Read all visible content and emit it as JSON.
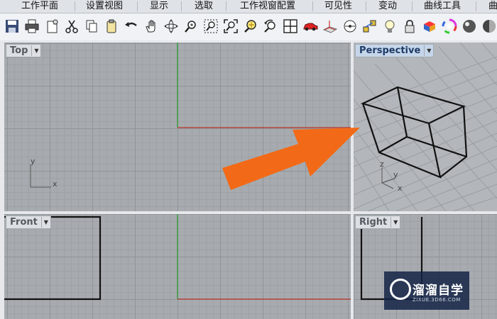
{
  "menu": {
    "tabs": [
      "工作平面",
      "设置视图",
      "显示",
      "选取",
      "工作视窗配置",
      "可见性",
      "变动",
      "曲线工具",
      "曲"
    ]
  },
  "toolbar": {
    "icons": [
      "save-icon",
      "print-icon",
      "page-setup-icon",
      "cut-icon",
      "copy-icon",
      "paste-icon",
      "undo-icon",
      "pan-icon",
      "rotate-view-icon",
      "zoom-icon",
      "zoom-window-icon",
      "zoom-extents-icon",
      "zoom-selected-icon",
      "undo-view-icon",
      "four-viewports-icon",
      "car-icon",
      "named-cplane-icon",
      "cplane-icon",
      "object-snap-icon",
      "light-icon",
      "lock-icon",
      "material-icon",
      "color-wheel-icon",
      "render-sphere-icon",
      "shaded-sphere-icon",
      "more-sphere-icon"
    ]
  },
  "viewports": {
    "top": {
      "label": "Top",
      "axis_x": "x",
      "axis_y": "y"
    },
    "persp": {
      "label": "Perspective",
      "axis_x": "x",
      "axis_y": "y",
      "axis_z": "z"
    },
    "front": {
      "label": "Front"
    },
    "right": {
      "label": "Right"
    }
  },
  "annotation": {
    "arrow_color": "#f26a17",
    "direction": "pointing toward Perspective viewport"
  },
  "colors": {
    "x_axis": "#b5443c",
    "y_axis": "#3e9a44",
    "active_label": "#c6d6ea"
  },
  "watermark": {
    "title": "溜溜自学",
    "subtitle": "ZIXUE.3D66.COM"
  }
}
